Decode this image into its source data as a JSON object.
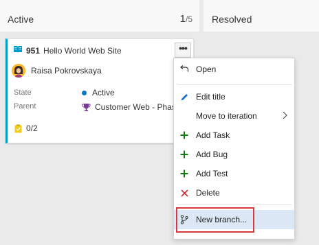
{
  "columns": [
    {
      "title": "Active",
      "wip_current": "1",
      "wip_separator": "/",
      "wip_max": "5"
    },
    {
      "title": "Resolved"
    }
  ],
  "card": {
    "id": "951",
    "title": "Hello World Web Site",
    "assignee": "Raisa Pokrovskaya",
    "state_label": "State",
    "state_value": "Active",
    "parent_label": "Parent",
    "parent_value": "Customer Web - Phase",
    "tasks": "0/2",
    "more_button": "•••",
    "accent_color": "#009ccc"
  },
  "context_menu": {
    "items": [
      {
        "label": "Open",
        "icon": "open-arrow-icon"
      },
      {
        "label": "Edit title",
        "icon": "pencil-icon"
      },
      {
        "label": "Move to iteration",
        "icon": "",
        "chevron": "›"
      },
      {
        "label": "Add Task",
        "icon": "plus-icon"
      },
      {
        "label": "Add Bug",
        "icon": "plus-icon"
      },
      {
        "label": "Add Test",
        "icon": "plus-icon"
      },
      {
        "label": "Delete",
        "icon": "x-icon"
      },
      {
        "label": "New branch...",
        "icon": "branch-icon"
      }
    ],
    "selected_item": "New branch...",
    "highlight_color": "#d9363e"
  }
}
